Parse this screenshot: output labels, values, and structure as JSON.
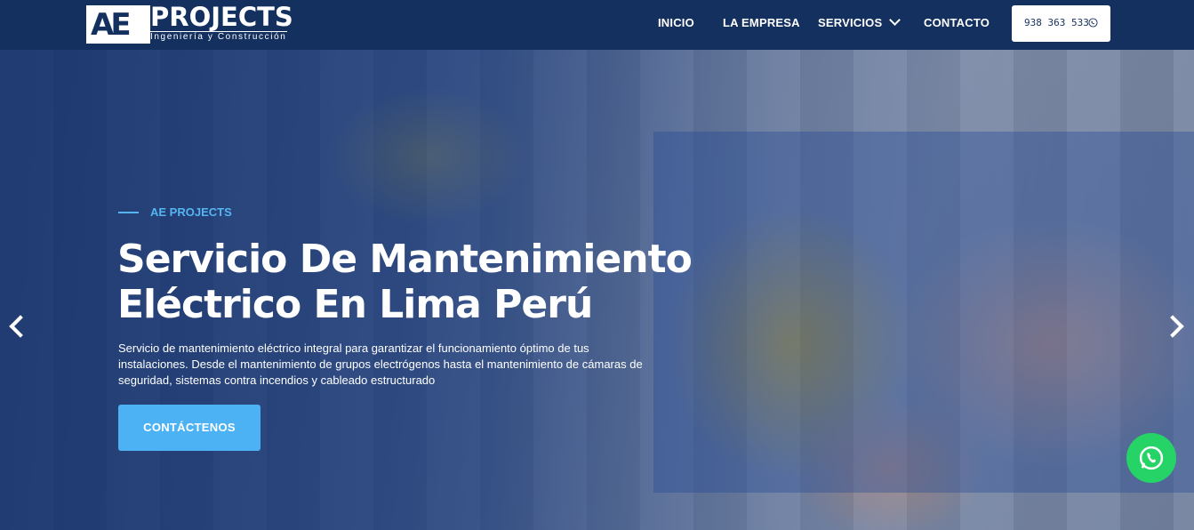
{
  "brand": {
    "mark": "AE",
    "name": "PROJECTS",
    "tagline": "Ingeniería y Construcción"
  },
  "nav": {
    "items": [
      {
        "label": "INICIO"
      },
      {
        "label": "LA EMPRESA"
      },
      {
        "label": "SERVICIOS"
      },
      {
        "label": "CONTACTO"
      }
    ],
    "phone": "938 363 533"
  },
  "hero": {
    "eyebrow": "AE PROJECTS",
    "title_line1": "Servicio De Mantenimiento",
    "title_line2": "Eléctrico En Lima Perú",
    "description": "Servicio de mantenimiento eléctrico integral para garantizar el funcionamiento óptimo de tus instalaciones. Desde el mantenimiento de grupos electrógenos hasta el mantenimiento de cámaras de seguridad, sistemas contra incendios y cableado estructurado",
    "cta_label": "CONTÁCTENOS"
  },
  "icons": {
    "prev": "chevron-left-icon",
    "next": "chevron-right-icon",
    "whatsapp": "whatsapp-icon",
    "dropdown": "chevron-down-icon"
  },
  "colors": {
    "header_bg": "#14305f",
    "accent": "#4db2f3",
    "whatsapp": "#25d366"
  }
}
